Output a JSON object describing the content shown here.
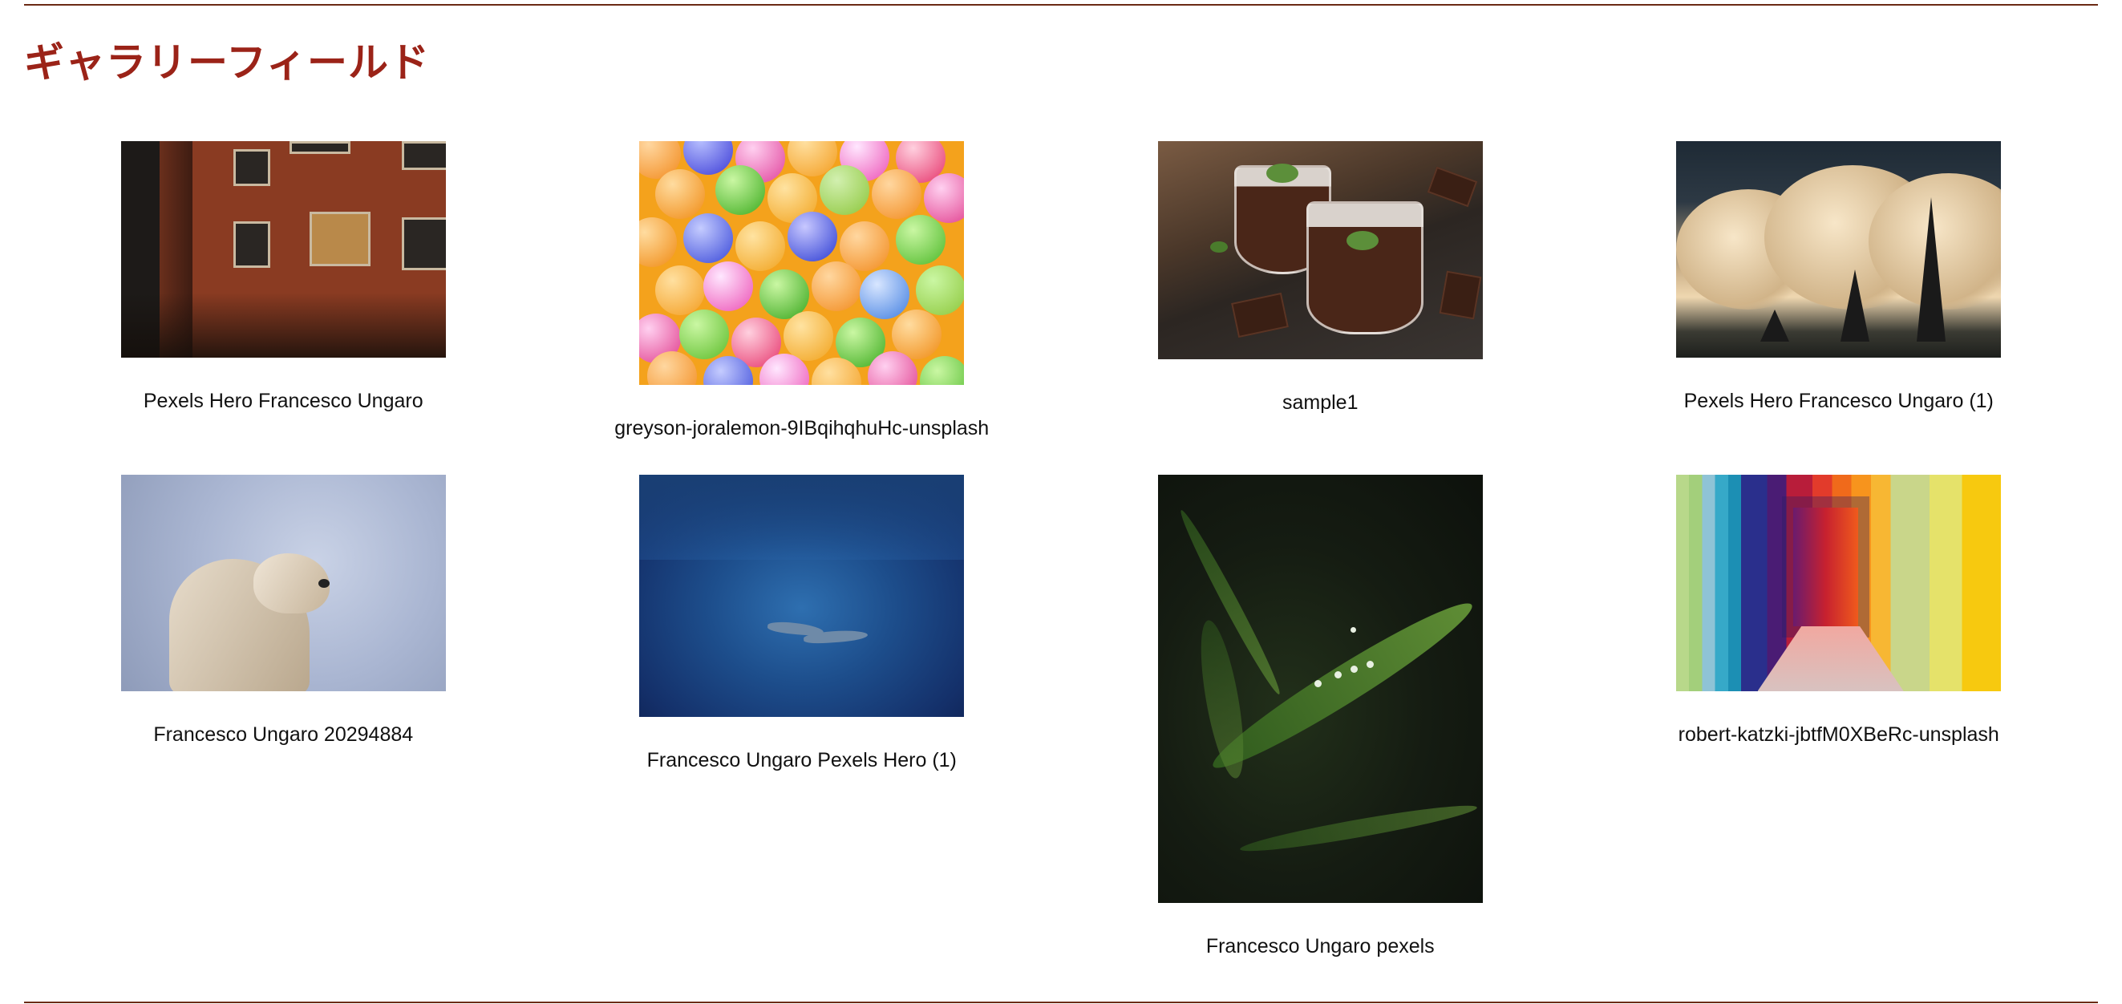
{
  "page": {
    "title": "ギャラリーフィールド"
  },
  "gallery": {
    "items": [
      {
        "caption": "Pexels Hero Francesco Ungaro",
        "image": "orange-building-facade"
      },
      {
        "caption": "greyson-joralemon-9IBqihqhuHc-unsplash",
        "image": "colorful-ball-pit"
      },
      {
        "caption": "sample1",
        "image": "chocolate-mousse-cups"
      },
      {
        "caption": "Pexels Hero Francesco Ungaro (1)",
        "image": "clouds-power-pylons"
      },
      {
        "caption": "Francesco Ungaro 20294884",
        "image": "polar-bear"
      },
      {
        "caption": "Francesco Ungaro Pexels Hero (1)",
        "image": "underwater-dolphins"
      },
      {
        "caption": "Francesco Ungaro pexels",
        "image": "grass-blade-dew-drops"
      },
      {
        "caption": "robert-katzki-jbtfM0XBeRc-unsplash",
        "image": "rainbow-tunnel"
      }
    ]
  },
  "colors": {
    "title": "#9b2318",
    "rule": "#6b2a14",
    "caption": "#111111",
    "background": "#ffffff"
  }
}
